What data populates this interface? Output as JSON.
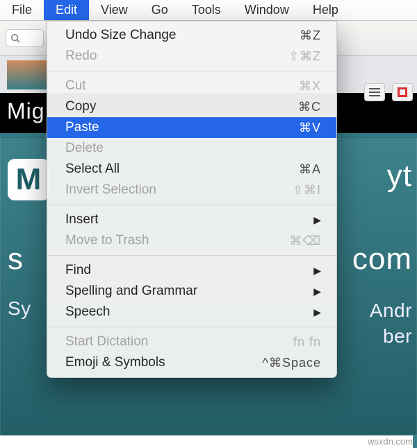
{
  "menubar": {
    "items": [
      {
        "label": "File"
      },
      {
        "label": "Edit"
      },
      {
        "label": "View"
      },
      {
        "label": "Go"
      },
      {
        "label": "Tools"
      },
      {
        "label": "Window"
      },
      {
        "label": "Help"
      }
    ],
    "active_index": 1
  },
  "dropdown": {
    "items": [
      {
        "label": "Undo Size Change",
        "shortcut": "⌘Z",
        "enabled": true
      },
      {
        "label": "Redo",
        "shortcut": "⇧⌘Z",
        "enabled": false
      },
      {
        "separator": true
      },
      {
        "label": "Cut",
        "shortcut": "⌘X",
        "enabled": false
      },
      {
        "label": "Copy",
        "shortcut": "⌘C",
        "enabled": true
      },
      {
        "label": "Paste",
        "shortcut": "⌘V",
        "enabled": true,
        "highlight": true
      },
      {
        "label": "Delete",
        "shortcut": "",
        "enabled": false
      },
      {
        "label": "Select All",
        "shortcut": "⌘A",
        "enabled": true
      },
      {
        "label": "Invert Selection",
        "shortcut": "⇧⌘I",
        "enabled": false
      },
      {
        "separator": true
      },
      {
        "label": "Insert",
        "submenu": true,
        "enabled": true
      },
      {
        "label": "Move to Trash",
        "shortcut": "⌘⌫",
        "enabled": false
      },
      {
        "separator": true
      },
      {
        "label": "Find",
        "submenu": true,
        "enabled": true
      },
      {
        "label": "Spelling and Grammar",
        "submenu": true,
        "enabled": true
      },
      {
        "label": "Speech",
        "submenu": true,
        "enabled": true
      },
      {
        "separator": true
      },
      {
        "label": "Start Dictation",
        "shortcut": "fn fn",
        "enabled": false
      },
      {
        "label": "Emoji & Symbols",
        "shortcut": "^⌘Space",
        "enabled": true
      }
    ]
  },
  "background": {
    "strip_text": "Mig",
    "logo_letter": "M",
    "right_top": "yt",
    "row2_left": "s",
    "row2_right": "com",
    "row3_left": "Sy",
    "row3_right_a": "Andr",
    "row3_right_b": "ber"
  },
  "watermark": "wsxdn.com"
}
